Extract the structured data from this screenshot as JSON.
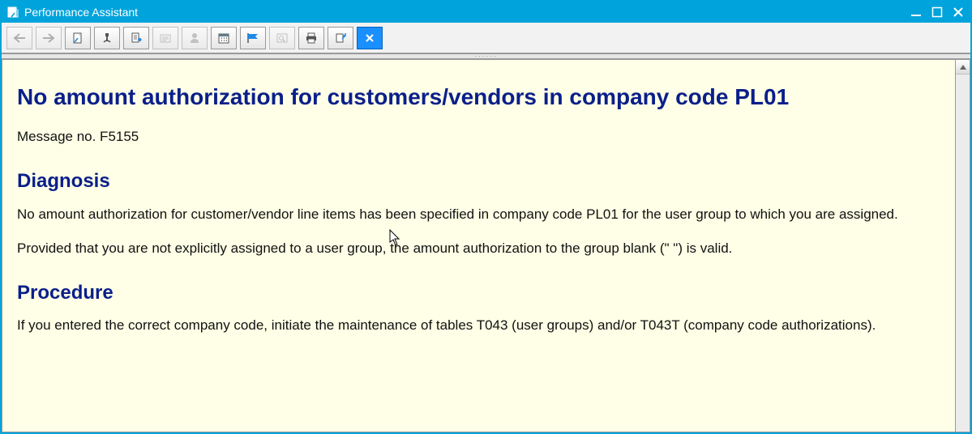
{
  "window": {
    "title": "Performance Assistant"
  },
  "toolbar": {
    "buttons": [
      {
        "name": "nav-back",
        "icon": "arrow-left-icon",
        "disabled": true
      },
      {
        "name": "nav-forward",
        "icon": "arrow-right-icon",
        "disabled": true
      },
      {
        "name": "doc-page",
        "icon": "document-icon",
        "disabled": false
      },
      {
        "name": "tech-info",
        "icon": "wrench-icon",
        "disabled": false
      },
      {
        "name": "application-help",
        "icon": "page-arrow-icon",
        "disabled": false
      },
      {
        "name": "customizing",
        "icon": "customizing-icon",
        "disabled": true
      },
      {
        "name": "personal-note",
        "icon": "person-icon",
        "disabled": true
      },
      {
        "name": "favorites",
        "icon": "calendar-icon",
        "disabled": false
      },
      {
        "name": "flag",
        "icon": "flag-icon",
        "disabled": false
      },
      {
        "name": "searchable",
        "icon": "search-doc-icon",
        "disabled": true
      },
      {
        "name": "print",
        "icon": "print-icon",
        "disabled": false
      },
      {
        "name": "export",
        "icon": "export-icon",
        "disabled": false
      },
      {
        "name": "close",
        "icon": "close-icon",
        "disabled": false,
        "close": true
      }
    ]
  },
  "doc": {
    "title": "No amount authorization for customers/vendors in company code PL01",
    "message_no": "Message no. F5155",
    "diagnosis_heading": "Diagnosis",
    "diagnosis_p1": "No amount authorization for customer/vendor line items has been specified in company code PL01 for the user group to which you are assigned.",
    "diagnosis_p2": "Provided that you are not explicitly assigned to a user group, the amount authorization to the group blank (\" \") is valid.",
    "procedure_heading": "Procedure",
    "procedure_p1": "If you entered the correct company code, initiate the maintenance of tables T043 (user groups) and/or T043T (company code authorizations)."
  }
}
